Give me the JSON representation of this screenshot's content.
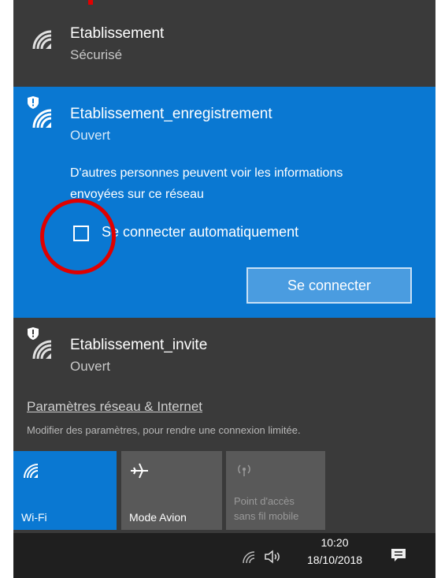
{
  "networks": [
    {
      "ssid": "Etablissement",
      "status": "Sécurisé"
    },
    {
      "ssid": "Etablissement_enregistrement",
      "status": "Ouvert",
      "warning": "D'autres personnes peuvent voir les informations envoyées sur ce réseau",
      "auto_connect_label": "Se connecter automatiquement",
      "auto_connect_checked": false,
      "connect_label": "Se connecter"
    },
    {
      "ssid": "Etablissement_invite",
      "status": "Ouvert"
    }
  ],
  "settings": {
    "link": "Paramètres réseau & Internet",
    "description": "Modifier des paramètres, pour rendre une connexion limitée."
  },
  "quick_actions": [
    {
      "label": "Wi-Fi",
      "icon": "wifi-icon",
      "active": true
    },
    {
      "label": "Mode Avion",
      "icon": "airplane-icon",
      "active": false
    },
    {
      "label_line1": "Point d'accès",
      "label_line2": "sans fil mobile",
      "icon": "hotspot-icon",
      "active": false
    }
  ],
  "taskbar": {
    "time": "10:20",
    "date": "18/10/2018"
  },
  "colors": {
    "accent": "#0a78d2",
    "panel": "#3a3a3a",
    "annotation": "#e00000"
  }
}
